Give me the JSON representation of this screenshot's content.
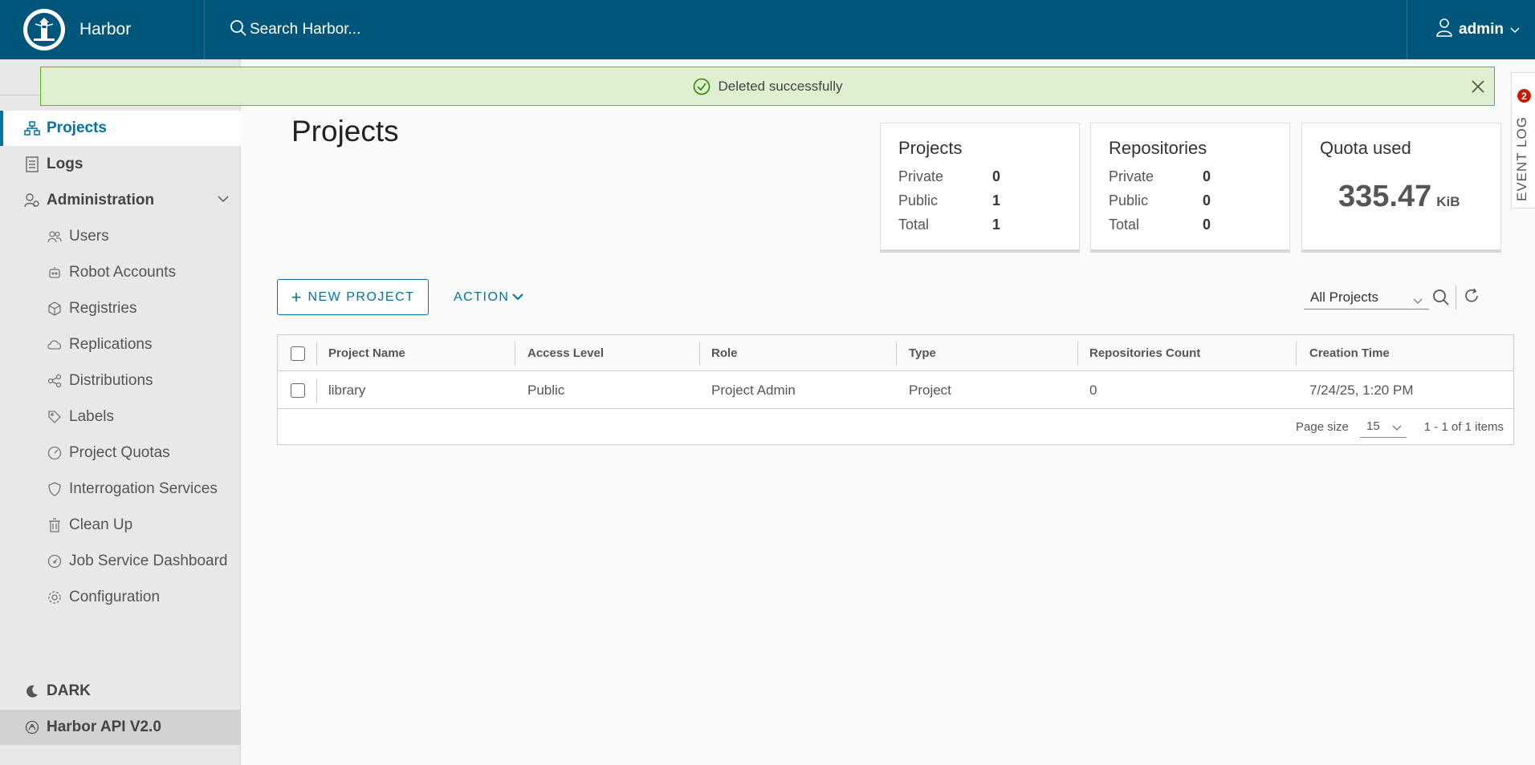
{
  "header": {
    "brand": "Harbor",
    "search_placeholder": "Search Harbor...",
    "user": "admin"
  },
  "alert": {
    "message": "Deleted successfully"
  },
  "event_log": {
    "label": "EVENT LOG",
    "badge": "2"
  },
  "sidebar": {
    "projects": "Projects",
    "logs": "Logs",
    "administration": "Administration",
    "items": [
      {
        "label": "Users",
        "icon": "users-icon"
      },
      {
        "label": "Robot Accounts",
        "icon": "robot-icon"
      },
      {
        "label": "Registries",
        "icon": "box-icon"
      },
      {
        "label": "Replications",
        "icon": "cloud-icon"
      },
      {
        "label": "Distributions",
        "icon": "share-icon"
      },
      {
        "label": "Labels",
        "icon": "tag-icon"
      },
      {
        "label": "Project Quotas",
        "icon": "gauge-icon"
      },
      {
        "label": "Interrogation Services",
        "icon": "shield-icon"
      },
      {
        "label": "Clean Up",
        "icon": "trash-icon"
      },
      {
        "label": "Job Service Dashboard",
        "icon": "dashboard-icon"
      },
      {
        "label": "Configuration",
        "icon": "gear-icon"
      }
    ],
    "dark": "DARK",
    "api": "Harbor API V2.0"
  },
  "page": {
    "title": "Projects"
  },
  "summary": {
    "projects": {
      "title": "Projects",
      "private_label": "Private",
      "private": "0",
      "public_label": "Public",
      "public": "1",
      "total_label": "Total",
      "total": "1"
    },
    "repositories": {
      "title": "Repositories",
      "private_label": "Private",
      "private": "0",
      "public_label": "Public",
      "public": "0",
      "total_label": "Total",
      "total": "0"
    },
    "quota": {
      "title": "Quota used",
      "value": "335.47",
      "unit": "KiB"
    }
  },
  "toolbar": {
    "new_project": "NEW PROJECT",
    "action": "ACTION",
    "filter": "All Projects"
  },
  "table": {
    "columns": [
      "Project Name",
      "Access Level",
      "Role",
      "Type",
      "Repositories Count",
      "Creation Time"
    ],
    "rows": [
      {
        "name": "library",
        "access": "Public",
        "role": "Project Admin",
        "type": "Project",
        "repos": "0",
        "created": "7/24/25, 1:20 PM"
      }
    ],
    "page_size_label": "Page size",
    "page_size": "15",
    "count": "1 - 1 of 1 items"
  },
  "colors": {
    "header": "#00567a",
    "accent": "#0072a3",
    "success_bg": "#dff0d0",
    "success_border": "#5eb715"
  }
}
